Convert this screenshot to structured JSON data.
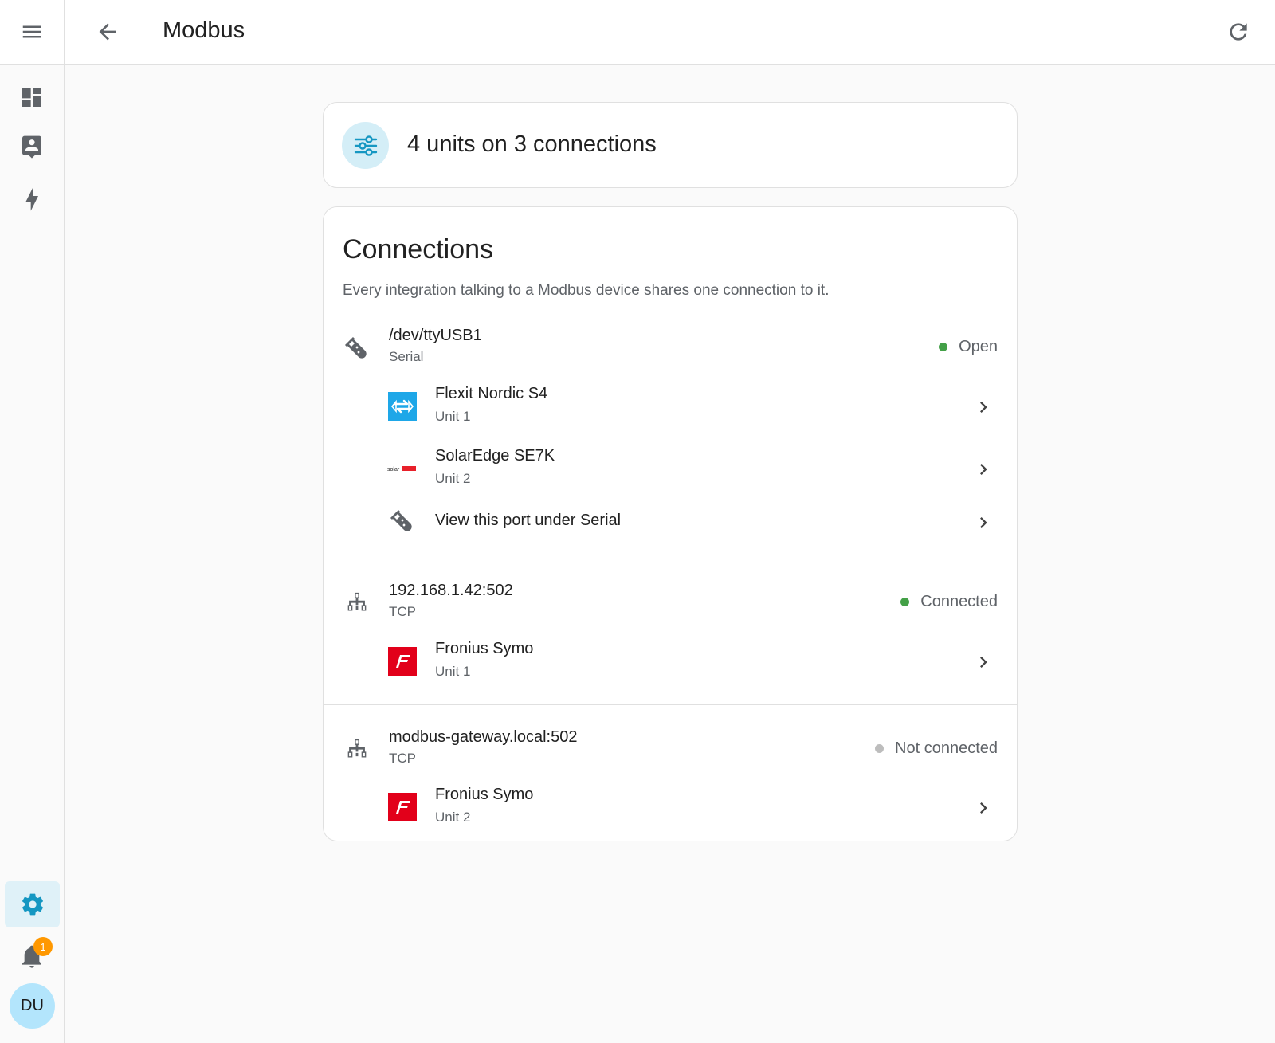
{
  "header": {
    "title": "Modbus"
  },
  "sidebar": {
    "items": [
      {
        "icon": "dashboard-icon"
      },
      {
        "icon": "person-card-icon"
      },
      {
        "icon": "lightning-bolt-icon"
      }
    ],
    "settings_icon": "gear-icon",
    "notifications_count": "1",
    "avatar_initials": "DU"
  },
  "summary": {
    "text": "4 units on 3 connections"
  },
  "connections": {
    "title": "Connections",
    "description": "Every integration talking to a Modbus device shares one connection to it.",
    "groups": [
      {
        "name": "/dev/ttyUSB1",
        "type": "Serial",
        "status": "Open",
        "status_color": "#43a047",
        "icon": "serial-cable-icon",
        "units": [
          {
            "name": "Flexit Nordic S4",
            "unit": "Unit 1",
            "logo": "flexit-logo"
          },
          {
            "name": "SolarEdge SE7K",
            "unit": "Unit 2",
            "logo": "solaredge-logo"
          }
        ],
        "link": "View this port under Serial"
      },
      {
        "name": "192.168.1.42:502",
        "type": "TCP",
        "status": "Connected",
        "status_color": "#43a047",
        "icon": "network-icon",
        "units": [
          {
            "name": "Fronius Symo",
            "unit": "Unit 1",
            "logo": "fronius-logo"
          }
        ]
      },
      {
        "name": "modbus-gateway.local:502",
        "type": "TCP",
        "status": "Not connected",
        "status_color": "#bdbdbd",
        "icon": "network-icon",
        "units": [
          {
            "name": "Fronius Symo",
            "unit": "Unit 2",
            "logo": "fronius-logo"
          }
        ]
      }
    ]
  },
  "logos": {
    "solaredge_text": "solar"
  }
}
